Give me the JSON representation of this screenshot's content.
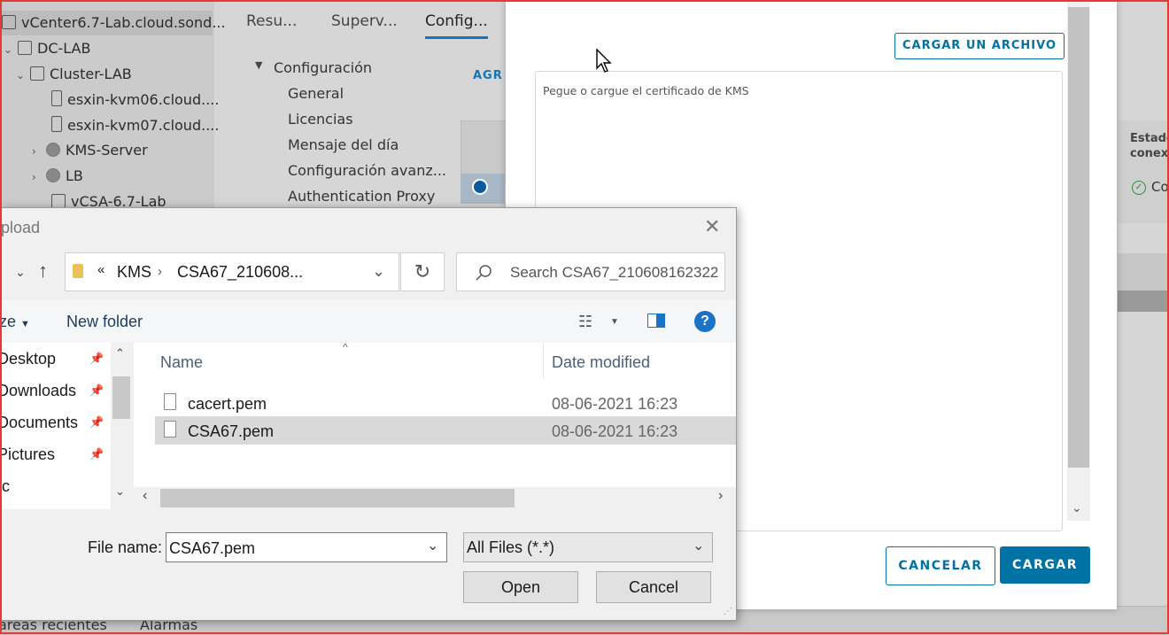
{
  "vcenter": {
    "tree": [
      {
        "label": "vCenter6.7-Lab.cloud.sond...",
        "depth": 0,
        "icon": "vcenter-icon",
        "selected": true
      },
      {
        "label": "DC-LAB",
        "depth": 1,
        "icon": "datacenter-icon"
      },
      {
        "label": "Cluster-LAB",
        "depth": 2,
        "icon": "cluster-icon"
      },
      {
        "label": "esxin-kvm06.cloud....",
        "depth": 3,
        "icon": "host-icon"
      },
      {
        "label": "esxin-kvm07.cloud....",
        "depth": 3,
        "icon": "host-icon"
      },
      {
        "label": "KMS-Server",
        "depth": 2,
        "icon": "vm-icon"
      },
      {
        "label": "LB",
        "depth": 2,
        "icon": "vm-icon"
      },
      {
        "label": "vCSA-6.7-Lab",
        "depth": 2,
        "icon": "vm-icon"
      }
    ],
    "tabs": [
      "Resu...",
      "Superv...",
      "Config..."
    ],
    "active_tab": "Config...",
    "config": {
      "section": "Configuración",
      "items": [
        "General",
        "Licencias",
        "Mensaje del día",
        "Configuración avanz...",
        "Authentication Proxy"
      ]
    },
    "peek_agr": "AGR",
    "right_header": "Estado\nconex",
    "right_status": "Co",
    "bottom_tabs": [
      "areas recientes",
      "Alarmas"
    ]
  },
  "modal": {
    "upload_button": "CARGAR UN ARCHIVO",
    "textarea_placeholder": "Pegue o cargue el certificado de KMS",
    "cancel_button": "CANCELAR",
    "submit_button": "CARGAR"
  },
  "dialog": {
    "title": "pload",
    "breadcrumb": {
      "prefix": "«",
      "segments": [
        "KMS",
        "CSA67_210608..."
      ]
    },
    "search_placeholder": "Search CSA67_210608162322",
    "organize_label": "ize",
    "new_folder_label": "New folder",
    "nav_items": [
      {
        "label": "Desktop",
        "pinned": true
      },
      {
        "label": "Downloads",
        "pinned": true
      },
      {
        "label": "Documents",
        "pinned": true
      },
      {
        "label": "Pictures",
        "pinned": true
      },
      {
        "label": "tc",
        "pinned": false
      }
    ],
    "columns": {
      "name": "Name",
      "date": "Date modified"
    },
    "files": [
      {
        "name": "cacert.pem",
        "date": "08-06-2021 16:23",
        "selected": false
      },
      {
        "name": "CSA67.pem",
        "date": "08-06-2021 16:23",
        "selected": true
      }
    ],
    "file_name_label": "File name:",
    "file_name_value": "CSA67.pem",
    "file_type_value": "All Files (*.*)",
    "open_button": "Open",
    "cancel_button": "Cancel"
  }
}
